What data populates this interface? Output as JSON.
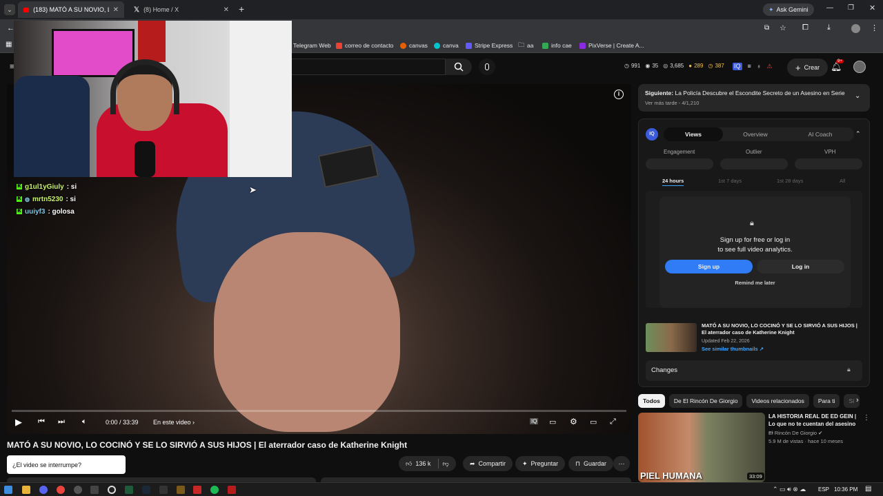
{
  "browser": {
    "tabs": [
      {
        "title": "(183) MATÓ A SU NOVIO, LO CO"
      },
      {
        "title": "(8) Home / X"
      }
    ],
    "new_tab": "+",
    "ask_gemini": "Ask Gemini"
  },
  "bookmarks": [
    {
      "label": "Telegram Web",
      "color": "#2aabee"
    },
    {
      "label": "correo de contacto",
      "color": "#ea4335"
    },
    {
      "label": "canvas",
      "color": "#e66000"
    },
    {
      "label": "canva",
      "color": "#00c4cc"
    },
    {
      "label": "Stripe Express",
      "color": "#635bff"
    },
    {
      "label": "aa",
      "color": "#9aa0a6"
    },
    {
      "label": "info cae",
      "color": "#34a853"
    },
    {
      "label": "PixVerse | Create A...",
      "color": "#8a2be2"
    }
  ],
  "yt_header": {
    "stats": [
      "991",
      "35",
      "3,685",
      "289",
      "387"
    ],
    "create_label": "Crear",
    "notif_badge": "9+"
  },
  "stream_chat": [
    {
      "user": "g1ul1yGiuly",
      "msg": ": si"
    },
    {
      "user": "mrtn5230",
      "msg": ": si"
    },
    {
      "user": "uuiyf3",
      "msg": ": golosa"
    }
  ],
  "player": {
    "time": "0:00 / 33:39",
    "chapter": "En este video",
    "progress": 0.0
  },
  "video": {
    "title": "MATÓ A SU NOVIO, LO COCINÓ Y SE LO SIRVIÓ A SUS HIJOS | El aterrador caso de Katherine Knight",
    "likes": "136 k",
    "share": "Compartir",
    "ask": "Preguntar",
    "save": "Guardar",
    "toast": "¿El video se interrumpe?"
  },
  "sidebar": {
    "next_label": "Siguiente:",
    "next_title": "La Policía Descubre el Escondite Secreto de un Asesino en Serie",
    "next_sub": "Ver más tarde - 4/1,210",
    "iq": {
      "logo": "IQ",
      "tabs": [
        "Views",
        "Overview",
        "AI Coach"
      ],
      "metrics": [
        "Engagement",
        "Outlier",
        "VPH"
      ],
      "ranges": [
        "24 hours",
        "1st 7 days",
        "1st 28 days",
        "All"
      ],
      "signup_text_1": "Sign up for free or log in",
      "signup_text_2": "to see full video analytics.",
      "signup_btn": "Sign up",
      "login_btn": "Log in",
      "remind": "Remind me later",
      "card_title": "MATÓ A SU NOVIO, LO COCINÓ Y SE LO SIRVIÓ A SUS HIJOS | El aterrador caso de Katherine Knight",
      "card_updated": "Updated Feb 22, 2026",
      "card_link": "See similar thumbnails",
      "changes": "Changes"
    },
    "chips": [
      "Todos",
      "De El Rincón De Giorgio",
      "Videos relacionados",
      "Para ti",
      "Sí"
    ],
    "rec": {
      "title": "LA HISTORIA REAL DE ED GEIN | Lo que no te cuentan del asesino ...",
      "channel": "El Rincón De Giorgio",
      "meta": "5.9 M de vistas · hace 10 meses",
      "duration": "33:09",
      "thumb_text": "PIEL HUMANA"
    }
  },
  "taskbar": {
    "lang": "ESP",
    "clock": "10:36 PM"
  }
}
